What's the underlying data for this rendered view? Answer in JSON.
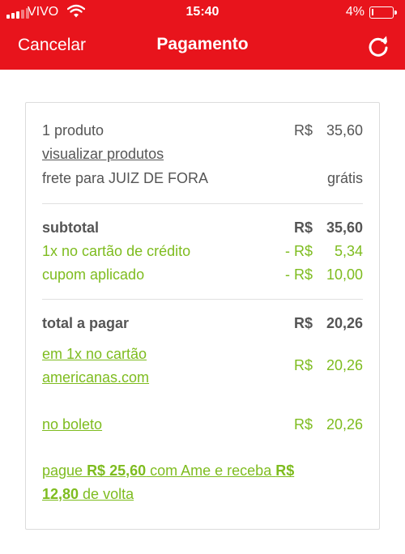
{
  "status_bar": {
    "carrier": "VIVO",
    "time": "15:40",
    "battery": "4%",
    "battery_level": 0.04
  },
  "header": {
    "cancel_label": "Cancelar",
    "title": "Pagamento",
    "refresh_icon": "refresh-icon",
    "background_color": "#e8141c"
  },
  "summary": {
    "items": {
      "label": "1 produto",
      "currency": "R$",
      "amount": "35,60"
    },
    "view_products_label": "visualizar produtos",
    "shipping": {
      "label": "frete para JUIZ DE FORA",
      "value": "grátis"
    },
    "subtotal": {
      "label": "subtotal",
      "currency": "R$",
      "amount": "35,60"
    },
    "card_discount": {
      "label": "1x no cartão de crédito",
      "currency": "- R$",
      "amount": "5,34"
    },
    "coupon": {
      "label": "cupom aplicado",
      "currency": "- R$",
      "amount": "10,00"
    },
    "total": {
      "label": "total a pagar",
      "currency": "R$",
      "amount": "20,26"
    },
    "card_option": {
      "line1": "em 1x no cartão",
      "line2": "americanas.com",
      "currency": "R$",
      "amount": "20,26"
    },
    "boleto_option": {
      "label": "no boleto",
      "currency": "R$",
      "amount": "20,26"
    },
    "ame_promo": {
      "text1": "pague ",
      "pay_amount": "R$ 25,60",
      "text2": " com Ame e receba ",
      "cashback_currency": "R$",
      "cashback_amount": "12,80",
      "text3": " de volta"
    }
  },
  "colors": {
    "accent_red": "#e8141c",
    "discount_green": "#7ebc1f",
    "text_gray": "#555555"
  }
}
